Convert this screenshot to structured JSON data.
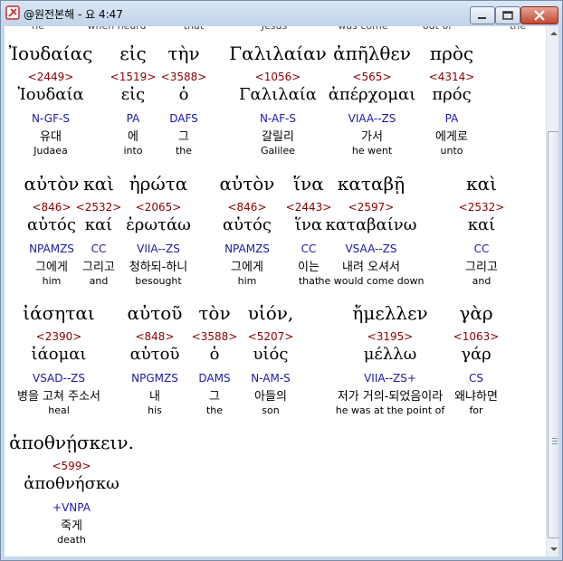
{
  "window": {
    "title": "@원전본해 - 요 4:47"
  },
  "top_clipped": [
    "he",
    "when heard",
    "that",
    "Jesus",
    "was come",
    "out of",
    "the"
  ],
  "rows": [
    [
      {
        "word": "Ἰουδαίας",
        "strong": "<2449>",
        "lemma": "Ἰουδαία",
        "parse": "N-GF-S",
        "korean": "유대",
        "english": "Judaea"
      },
      {
        "word": "εἰς",
        "strong": "<1519>",
        "lemma": "εἰς",
        "parse": "PA",
        "korean": "에",
        "english": "into"
      },
      {
        "word": "τὴν",
        "strong": "<3588>",
        "lemma": "ὁ",
        "parse": "DAFS",
        "korean": "그",
        "english": "the"
      },
      {
        "word": "Γαλιλαίαν",
        "strong": "<1056>",
        "lemma": "Γαλιλαία",
        "parse": "N-AF-S",
        "korean": "갈릴리",
        "english": "Galilee"
      },
      {
        "word": "ἀπῆλθεν",
        "strong": "<565>",
        "lemma": "ἀπέρχομαι",
        "parse": "VIAA--ZS",
        "korean": "가서",
        "english": "he went"
      },
      {
        "word": "πρὸς",
        "strong": "<4314>",
        "lemma": "πρός",
        "parse": "PA",
        "korean": "에게로",
        "english": "unto"
      }
    ],
    [
      {
        "word": "αὐτὸν",
        "strong": "<846>",
        "lemma": "αὐτός",
        "parse": "NPAMZS",
        "korean": "그에게",
        "english": "him"
      },
      {
        "word": "καὶ",
        "strong": "<2532>",
        "lemma": "καί",
        "parse": "CC",
        "korean": "그리고",
        "english": "and"
      },
      {
        "word": "ἠρώτα",
        "strong": "<2065>",
        "lemma": "ἐρωτάω",
        "parse": "VIIA--ZS",
        "korean": "청하되-하니",
        "english": "besought"
      },
      {
        "word": "αὐτὸν",
        "strong": "<846>",
        "lemma": "αὐτός",
        "parse": "NPAMZS",
        "korean": "그에게",
        "english": "him"
      },
      {
        "word": "ἵνα",
        "strong": "<2443>",
        "lemma": "ἵνα",
        "parse": "CC",
        "korean": "이는",
        "english": "that"
      },
      {
        "word": "καταβῇ",
        "strong": "<2597>",
        "lemma": "καταβαίνω",
        "parse": "VSAA--ZS",
        "korean": "내려 오셔서",
        "english": "he would come down"
      },
      {
        "word": "καὶ",
        "strong": "<2532>",
        "lemma": "καί",
        "parse": "CC",
        "korean": "그리고",
        "english": "and"
      }
    ],
    [
      {
        "word": "ἰάσηται",
        "strong": "<2390>",
        "lemma": "ἰάομαι",
        "parse": "VSAD--ZS",
        "korean": "병을 고쳐 주소서",
        "english": "heal"
      },
      {
        "word": "αὐτοῦ",
        "strong": "<848>",
        "lemma": "αὑτοῦ",
        "parse": "NPGMZS",
        "korean": "내",
        "english": "his"
      },
      {
        "word": "τὸν",
        "strong": "<3588>",
        "lemma": "ὁ",
        "parse": "DAMS",
        "korean": "그",
        "english": "the"
      },
      {
        "word": "υἱόν,",
        "strong": "<5207>",
        "lemma": "υἱός",
        "parse": "N-AM-S",
        "korean": "아들의",
        "english": "son"
      },
      {
        "word": "ἤμελλεν",
        "strong": "<3195>",
        "lemma": "μέλλω",
        "parse": "VIIA--ZS+",
        "korean": "저가 거의-되었음이라",
        "english": "he was at the point of"
      },
      {
        "word": "γὰρ",
        "strong": "<1063>",
        "lemma": "γάρ",
        "parse": "CS",
        "korean": "왜냐하면",
        "english": "for"
      }
    ],
    [
      {
        "word": "ἀποθνῄσκειν.",
        "strong": "<599>",
        "lemma": "ἀποθνήσκω",
        "parse": "+VNPA",
        "korean": "죽게",
        "english": "death"
      }
    ]
  ]
}
